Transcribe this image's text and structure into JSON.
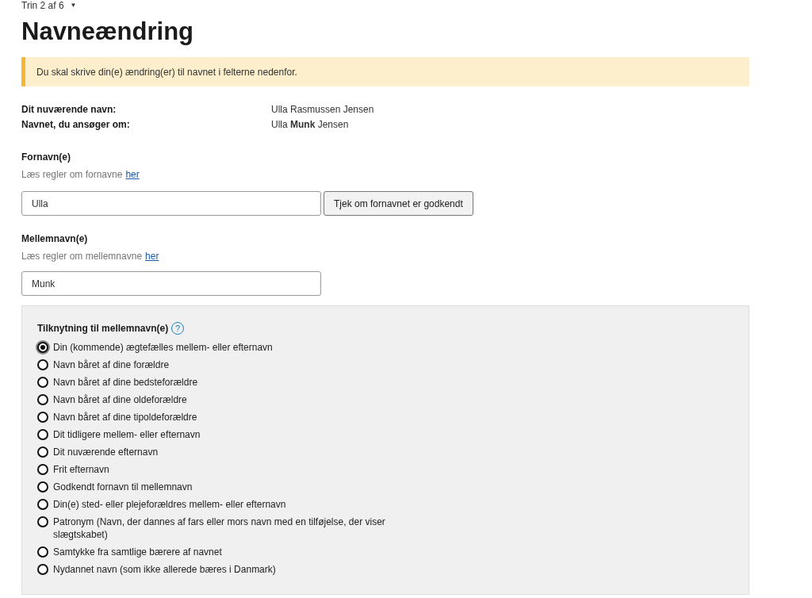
{
  "step": {
    "label": "Trin 2 af 6",
    "caret": "▼"
  },
  "title": "Navneændring",
  "alert": {
    "text": "Du skal skrive din(e) ændring(er) til navnet i felterne nedenfor."
  },
  "summary": [
    {
      "label": "Dit nuværende navn:",
      "value": "Ulla Rasmussen Jensen"
    },
    {
      "label": "Navnet, du ansøger om:",
      "value": "Ulla **Munk** Jensen"
    }
  ],
  "first_names": {
    "label": "Fornavn(e)",
    "hint": "Læs regler om fornavne",
    "link": "her",
    "value": "Ulla",
    "button": "Tjek om fornavnet er godkendt"
  },
  "middle_names": {
    "label": "Mellemnavn(e)",
    "hint": "Læs regler om mellemnavne",
    "link": "her",
    "value": "Munk"
  },
  "connection": {
    "legend": "Tilknytning til mellemnavn(e)",
    "help": "?",
    "options": [
      {
        "label": "Din (kommende) ægtefælles mellem- eller efternavn",
        "selected": true
      },
      {
        "label": "Navn båret af dine forældre",
        "selected": false
      },
      {
        "label": "Navn båret af dine bedsteforældre",
        "selected": false
      },
      {
        "label": "Navn båret af dine oldeforældre",
        "selected": false
      },
      {
        "label": "Navn båret af dine tipoldeforældre",
        "selected": false
      },
      {
        "label": "Dit tidligere mellem- eller efternavn",
        "selected": false
      },
      {
        "label": "Dit nuværende efternavn",
        "selected": false
      },
      {
        "label": "Frit efternavn",
        "selected": false
      },
      {
        "label": "Godkendt fornavn til mellemnavn",
        "selected": false
      },
      {
        "label": "Din(e) sted- eller plejeforældres mellem- eller efternavn",
        "selected": false
      },
      {
        "label": "Patronym (Navn, der dannes af fars eller mors navn med en tilføjelse, der viser slægtskabet)",
        "selected": false
      },
      {
        "label": "Samtykke fra samtlige bærere af navnet",
        "selected": false
      },
      {
        "label": "Nydannet navn (som ikke allerede bæres i Danmark)",
        "selected": false
      }
    ]
  }
}
